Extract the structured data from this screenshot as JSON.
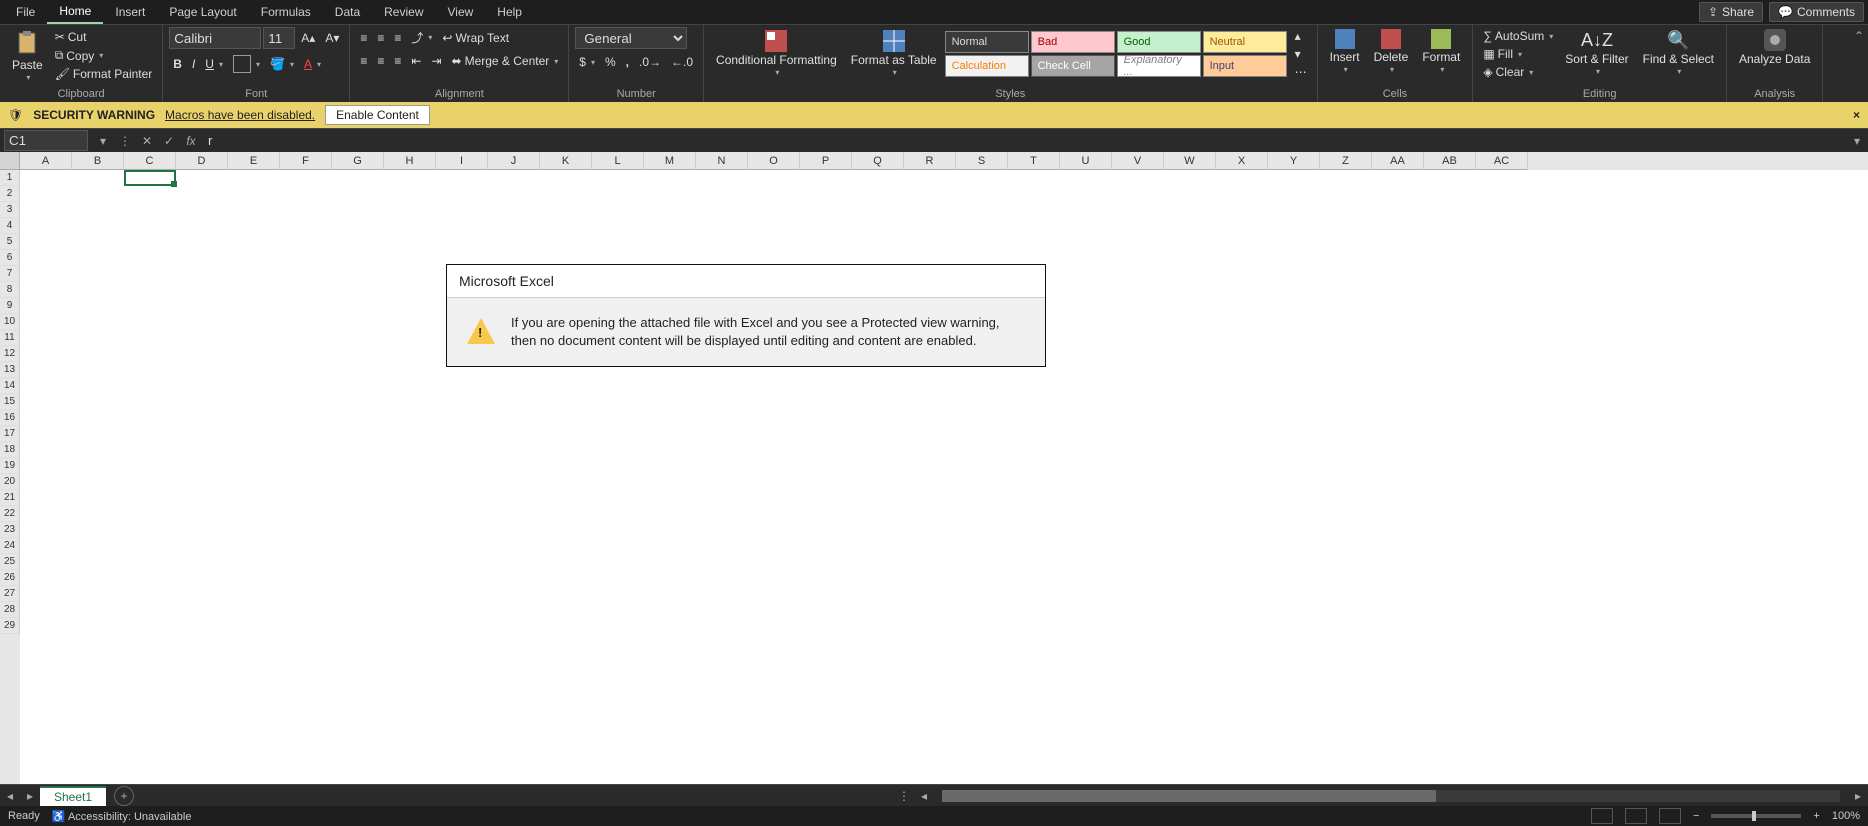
{
  "tabs": [
    "File",
    "Home",
    "Insert",
    "Page Layout",
    "Formulas",
    "Data",
    "Review",
    "View",
    "Help"
  ],
  "active_tab": "Home",
  "share": "Share",
  "comments": "Comments",
  "clipboard": {
    "label": "Clipboard",
    "paste": "Paste",
    "cut": "Cut",
    "copy": "Copy",
    "painter": "Format Painter"
  },
  "font": {
    "label": "Font",
    "name": "Calibri",
    "size": "11"
  },
  "alignment": {
    "label": "Alignment",
    "wrap": "Wrap Text",
    "merge": "Merge & Center"
  },
  "number": {
    "label": "Number",
    "format": "General"
  },
  "styles": {
    "label": "Styles",
    "cond": "Conditional Formatting",
    "table": "Format as Table",
    "s1": "Normal",
    "s2": "Bad",
    "s3": "Good",
    "s4": "Neutral",
    "s5": "Calculation",
    "s6": "Check Cell",
    "s7": "Explanatory ...",
    "s8": "Input"
  },
  "cells": {
    "label": "Cells",
    "insert": "Insert",
    "delete": "Delete",
    "format": "Format"
  },
  "editing": {
    "label": "Editing",
    "autosum": "AutoSum",
    "fill": "Fill",
    "clear": "Clear",
    "sort": "Sort & Filter",
    "find": "Find & Select"
  },
  "analysis": {
    "label": "Analysis",
    "analyze": "Analyze Data"
  },
  "security": {
    "title": "SECURITY WARNING",
    "msg": "Macros have been disabled.",
    "enable": "Enable Content"
  },
  "namebox": "C1",
  "formula": "r",
  "columns": [
    "A",
    "B",
    "C",
    "D",
    "E",
    "F",
    "G",
    "H",
    "I",
    "J",
    "K",
    "L",
    "M",
    "N",
    "O",
    "P",
    "Q",
    "R",
    "S",
    "T",
    "U",
    "V",
    "W",
    "X",
    "Y",
    "Z",
    "AA",
    "AB",
    "AC"
  ],
  "rows": [
    "1",
    "2",
    "3",
    "4",
    "5",
    "6",
    "7",
    "8",
    "9",
    "10",
    "11",
    "12",
    "13",
    "14",
    "15",
    "16",
    "17",
    "18",
    "19",
    "20",
    "21",
    "22",
    "23",
    "24",
    "25",
    "26",
    "27",
    "28",
    "29"
  ],
  "dialog": {
    "title": "Microsoft Excel",
    "line1": "If you are opening the attached file with Excel and you see a Protected view warning,",
    "line2": "then no document content will be displayed until editing and content are enabled."
  },
  "sheet": "Sheet1",
  "status": {
    "ready": "Ready",
    "access": "Accessibility: Unavailable",
    "zoom": "100%"
  }
}
